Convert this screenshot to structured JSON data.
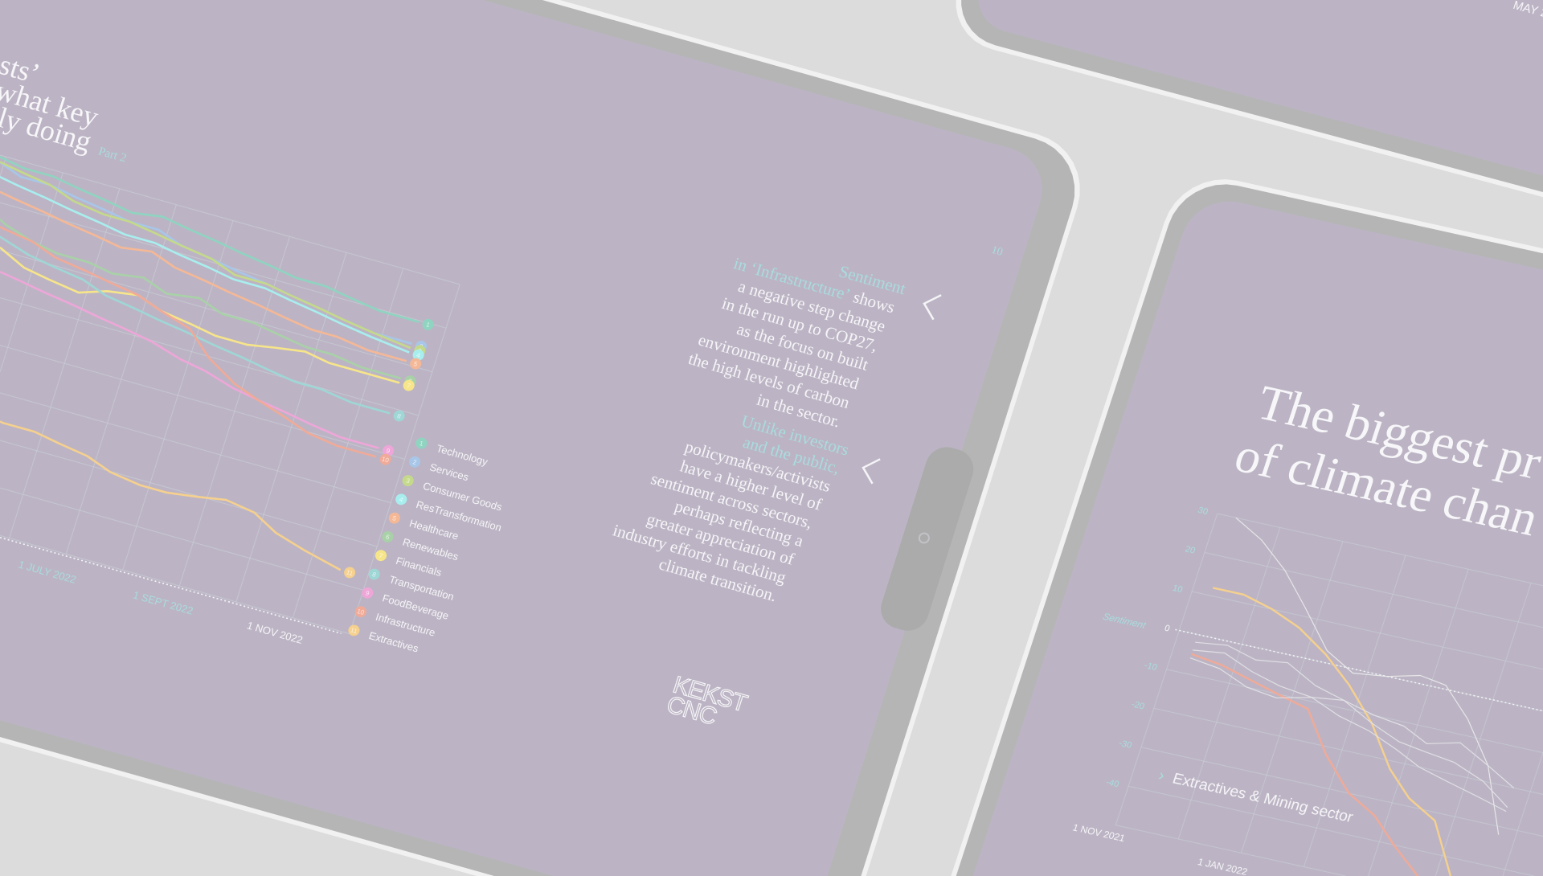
{
  "colors": {
    "background": "#dcdcdc",
    "bezel": "#b5b5b5",
    "screen": "#bcb4c4",
    "accent_teal": "#a9dcdf",
    "text_white": "#f5f4f7",
    "grid": "#cdd6de"
  },
  "main_slide": {
    "title_lines": [
      "sts’",
      "what key",
      "ly doing"
    ],
    "title_suffix": "Part 2",
    "page_number": "10",
    "paragraph1": {
      "highlight_line1": "Sentiment",
      "highlight_line2": "in ‘Infrastructure’",
      "line2_rest": " shows",
      "lines": [
        "a negative step change",
        "in the run up to COP27,",
        "as the focus on built",
        "environment highlighted",
        "the high levels of carbon",
        "in the sector."
      ]
    },
    "paragraph2": {
      "highlight_lines": [
        "Unlike investors",
        "and the public,"
      ],
      "lines": [
        "policymakers/activists",
        "have a higher level of",
        "sentiment across sectors,",
        "perhaps reflecting a",
        "greater appreciation of",
        "industry efforts in tackling",
        "climate transition."
      ]
    },
    "prev_icon": "chevron-left-icon",
    "logo": [
      "KEKST",
      "CNC"
    ]
  },
  "right_slide": {
    "title_lines": [
      "The biggest pr",
      "of climate chan"
    ]
  },
  "top_slide": {
    "date_fragment": "MAY 2"
  },
  "chart_data": [
    {
      "type": "line",
      "title": "",
      "x_tick_labels": [
        "1 JULY 2022",
        "1 SEPT 2022",
        "1 NOV 2022"
      ],
      "x": [
        "2022-03-01",
        "2022-03-15",
        "2022-04-01",
        "2022-04-15",
        "2022-05-01",
        "2022-05-15",
        "2022-06-01",
        "2022-06-15",
        "2022-07-01",
        "2022-07-15",
        "2022-08-01",
        "2022-08-15",
        "2022-09-01",
        "2022-09-15",
        "2022-10-01",
        "2022-10-15",
        "2022-11-01",
        "2022-11-22"
      ],
      "grid": true,
      "legend_position": "right",
      "series": [
        {
          "id": "1",
          "name": "Technology",
          "color": "#8fd4c0",
          "values": [
            82,
            81,
            80,
            79,
            79,
            78,
            77,
            76,
            77,
            76,
            75,
            74,
            73,
            72,
            72,
            71,
            70,
            70
          ]
        },
        {
          "id": "2",
          "name": "Services",
          "color": "#a8c6e8",
          "values": [
            80,
            79,
            79,
            77,
            77,
            76,
            75,
            74,
            74,
            72,
            71,
            70,
            69,
            68,
            67,
            66,
            65,
            65
          ]
        },
        {
          "id": "3",
          "name": "Consumer Goods",
          "color": "#c5d98a",
          "values": [
            81,
            80,
            79,
            78,
            77,
            75,
            74,
            74,
            73,
            72,
            71,
            69,
            69,
            68,
            67,
            66,
            65,
            64
          ]
        },
        {
          "id": "4",
          "name": "ResTransformation",
          "color": "#a8eeee",
          "values": [
            78,
            77,
            76,
            75,
            74,
            73,
            72,
            71,
            71,
            70,
            69,
            68,
            68,
            67,
            66,
            65,
            64,
            63
          ]
        },
        {
          "id": "5",
          "name": "Healthcare",
          "color": "#f5b896",
          "values": [
            74,
            73,
            73,
            72,
            71,
            70,
            69,
            68,
            69,
            67,
            66,
            65,
            64,
            63,
            62,
            62,
            61,
            61
          ]
        },
        {
          "id": "6",
          "name": "Renewables",
          "color": "#a9d1a8",
          "values": [
            72,
            70,
            69,
            66,
            64,
            63,
            63,
            62,
            63,
            61,
            62,
            60,
            60,
            59,
            58,
            58,
            57,
            57
          ]
        },
        {
          "id": "7",
          "name": "Financials",
          "color": "#f7e58a",
          "values": [
            70,
            68,
            64,
            61,
            58,
            57,
            56,
            58,
            59,
            57,
            56,
            55,
            55,
            56,
            57,
            56,
            56,
            56
          ]
        },
        {
          "id": "8",
          "name": "Transportation",
          "color": "#9fd6d6",
          "values": [
            69,
            67,
            65,
            63,
            61,
            60,
            59,
            57,
            56,
            55,
            54,
            53,
            52,
            51,
            50,
            50,
            49,
            49
          ]
        },
        {
          "id": "9",
          "name": "FoodBeverage",
          "color": "#eea6d8",
          "values": [
            60,
            59,
            58,
            56,
            55,
            54,
            53,
            52,
            51,
            50,
            48,
            47,
            45,
            44,
            43,
            42,
            41,
            41
          ]
        },
        {
          "id": "10",
          "name": "Infrastructure",
          "color": "#f0aa98",
          "values": [
            68,
            67,
            66,
            65,
            64,
            62,
            61,
            60,
            59,
            57,
            55,
            50,
            46,
            44,
            42,
            40,
            39,
            39
          ]
        },
        {
          "id": "11",
          "name": "Extractives",
          "color": "#f5d08e",
          "values": [
            40,
            36,
            32,
            28,
            25,
            24,
            24,
            23,
            22,
            20,
            19,
            19,
            20,
            21,
            20,
            17,
            15,
            13
          ]
        }
      ]
    },
    {
      "type": "line",
      "title": "",
      "ylabel": "Sentiment",
      "y_ticks": [
        "30",
        "20",
        "10",
        "0",
        "-10",
        "-20",
        "-30",
        "-40"
      ],
      "ylim": [
        -50,
        30
      ],
      "x_tick_labels": [
        "1 NOV 2021",
        "1 JAN 2022"
      ],
      "annotation": "Extractives & Mining sector",
      "grid": true,
      "x": [
        "2021-11-10",
        "2021-11-25",
        "2021-12-10",
        "2021-12-25",
        "2022-01-10",
        "2022-01-25",
        "2022-02-10",
        "2022-02-25",
        "2022-03-10",
        "2022-03-25",
        "2022-04-10",
        "2022-04-25"
      ],
      "series": [
        {
          "color": "#f5d08e",
          "values": [
            12,
            12,
            10,
            7,
            2,
            -4,
            -12,
            -22,
            -28,
            -32,
            -45,
            -48
          ]
        },
        {
          "color": "#f0aa98",
          "values": [
            -5,
            -6,
            -8,
            -10,
            -12,
            -22,
            -30,
            -34,
            -40,
            -46,
            -50,
            -49
          ]
        },
        {
          "color": "#eeeeee",
          "values": [
            30,
            26,
            20,
            12,
            3,
            -1,
            0,
            2,
            1,
            -6,
            -16,
            -32
          ]
        },
        {
          "color": "#e6e6ea",
          "values": [
            -2,
            -1,
            -3,
            -2,
            -6,
            -8,
            -10,
            -11,
            -14,
            -12,
            -16,
            -20
          ]
        },
        {
          "color": "#e6e6ea",
          "values": [
            -6,
            -7,
            -10,
            -11,
            -9,
            -8,
            -12,
            -15,
            -16,
            -17,
            -20,
            -25
          ]
        },
        {
          "color": "#e6e6ea",
          "values": [
            -4,
            -3,
            -6,
            -8,
            -9,
            -12,
            -14,
            -17,
            -20,
            -22,
            -24,
            -26
          ]
        }
      ]
    }
  ]
}
